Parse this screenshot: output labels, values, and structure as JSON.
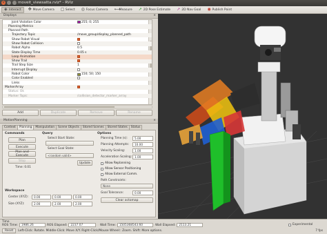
{
  "window": {
    "title": "moveit_viewsatta.rviz* - RViz"
  },
  "toolbar": [
    {
      "label": "Interact",
      "icon": "interact-icon",
      "active": true
    },
    {
      "label": "Move Camera",
      "icon": "move-camera-icon"
    },
    {
      "label": "Select",
      "icon": "select-icon"
    },
    {
      "label": "Focus Camera",
      "icon": "focus-camera-icon"
    },
    {
      "label": "Measure",
      "icon": "measure-icon"
    },
    {
      "label": "2D Pose Estimate",
      "icon": "pose-estimate-icon"
    },
    {
      "label": "2D Nav Goal",
      "icon": "nav-goal-icon"
    },
    {
      "label": "Publish Point",
      "icon": "publish-point-icon"
    }
  ],
  "displays": {
    "title": "Displays",
    "rows": [
      {
        "label": "Joint Violation Color",
        "indent": 2,
        "color": "#b00cb0",
        "value": "255; 0; 255"
      },
      {
        "label": "Planning Metrics",
        "indent": 1
      },
      {
        "label": "Planned Path",
        "indent": 1
      },
      {
        "label": "Trajectory Topic",
        "indent": 2,
        "value": "/move_group/display_planned_path"
      },
      {
        "label": "Show Robot Visual",
        "indent": 2,
        "check": true
      },
      {
        "label": "Show Robot Collision",
        "indent": 2,
        "check": false
      },
      {
        "label": "Robot Alpha",
        "indent": 2,
        "value": "0.5"
      },
      {
        "label": "State Display Time",
        "indent": 2,
        "value": "0.05 s"
      },
      {
        "label": "Loop Animation",
        "indent": 2,
        "check": true,
        "selected": true
      },
      {
        "label": "Show Trail",
        "indent": 2,
        "check": true
      },
      {
        "label": "Trail Step Size",
        "indent": 2,
        "value": "1"
      },
      {
        "label": "Interrupt Display",
        "indent": 2,
        "check": false
      },
      {
        "label": "Robot Color",
        "indent": 2,
        "color": "#969632",
        "value": "150; 50; 150"
      },
      {
        "label": "Color Enabled",
        "indent": 2,
        "check": false
      },
      {
        "label": "Links",
        "indent": 2
      },
      {
        "label": "MarkerArray",
        "indent": 0,
        "check": true
      },
      {
        "label": "Status: Ok",
        "indent": 1,
        "disabled": true
      },
      {
        "label": "Marker Topic",
        "indent": 1,
        "disabled": true,
        "value": "/collision_detector_marker_array"
      }
    ],
    "buttons": {
      "add": "Add",
      "duplicate": "Duplicate",
      "remove": "Remove",
      "rename": "Rename"
    }
  },
  "motion_planning": {
    "title": "MotionPlanning",
    "tabs": [
      "Context",
      "Planning",
      "Manipulation",
      "Scene Objects",
      "Stored Scenes",
      "Stored States",
      "Status"
    ],
    "active_tab": "Planning",
    "commands": {
      "heading": "Commands",
      "plan": "Plan",
      "execute": "Execute",
      "plan_execute": "Plan and Execute",
      "stop": "Stop",
      "time_label": "Time: 0.01"
    },
    "query": {
      "heading": "Query",
      "start_label": "Select Start State:",
      "start_value": "",
      "goal_label": "Select Goal State:",
      "goal_value": "<random valid>",
      "update": "Update"
    },
    "options": {
      "heading": "Options",
      "planning_time_label": "Planning Time (s):",
      "planning_time": "5.00",
      "attempts_label": "Planning Attempts:",
      "attempts": "10.00",
      "velocity_label": "Velocity Scaling:",
      "velocity": "1.00",
      "accel_label": "Acceleration Scaling:",
      "accel": "1.00",
      "replanning": "Allow Replanning",
      "sensor": "Allow Sensor Positioning",
      "external": "Allow External Comm.",
      "constraints_label": "Path Constraints:",
      "constraints_value": "None",
      "goal_tol_label": "Goal Tolerance:",
      "goal_tol": "0.00",
      "clear_octomap": "Clear octomap"
    },
    "workspace": {
      "heading": "Workspace",
      "center_label": "Center (XYZ):",
      "center": [
        "0.00",
        "0.00",
        "0.00"
      ],
      "size_label": "Size (XYZ):",
      "size": [
        "2.00",
        "2.00",
        "2.00"
      ]
    }
  },
  "time": {
    "title": "Time",
    "ros_time_label": "ROS Time:",
    "ros_time": "1986.26",
    "ros_elapsed_label": "ROS Elapsed:",
    "ros_elapsed": "2237.07",
    "wall_time_label": "Wall Time:",
    "wall_time": "1505368543.60",
    "wall_elapsed_label": "Wall Elapsed:",
    "wall_elapsed": "2113.21",
    "experimental": "Experimental",
    "reset": "Reset",
    "hint": "Left-Click: Rotate. Middle-Click: Move X/Y. Right-Click/Mouse Wheel:: Zoom. Shift: More options.",
    "fps": "7 fps"
  }
}
